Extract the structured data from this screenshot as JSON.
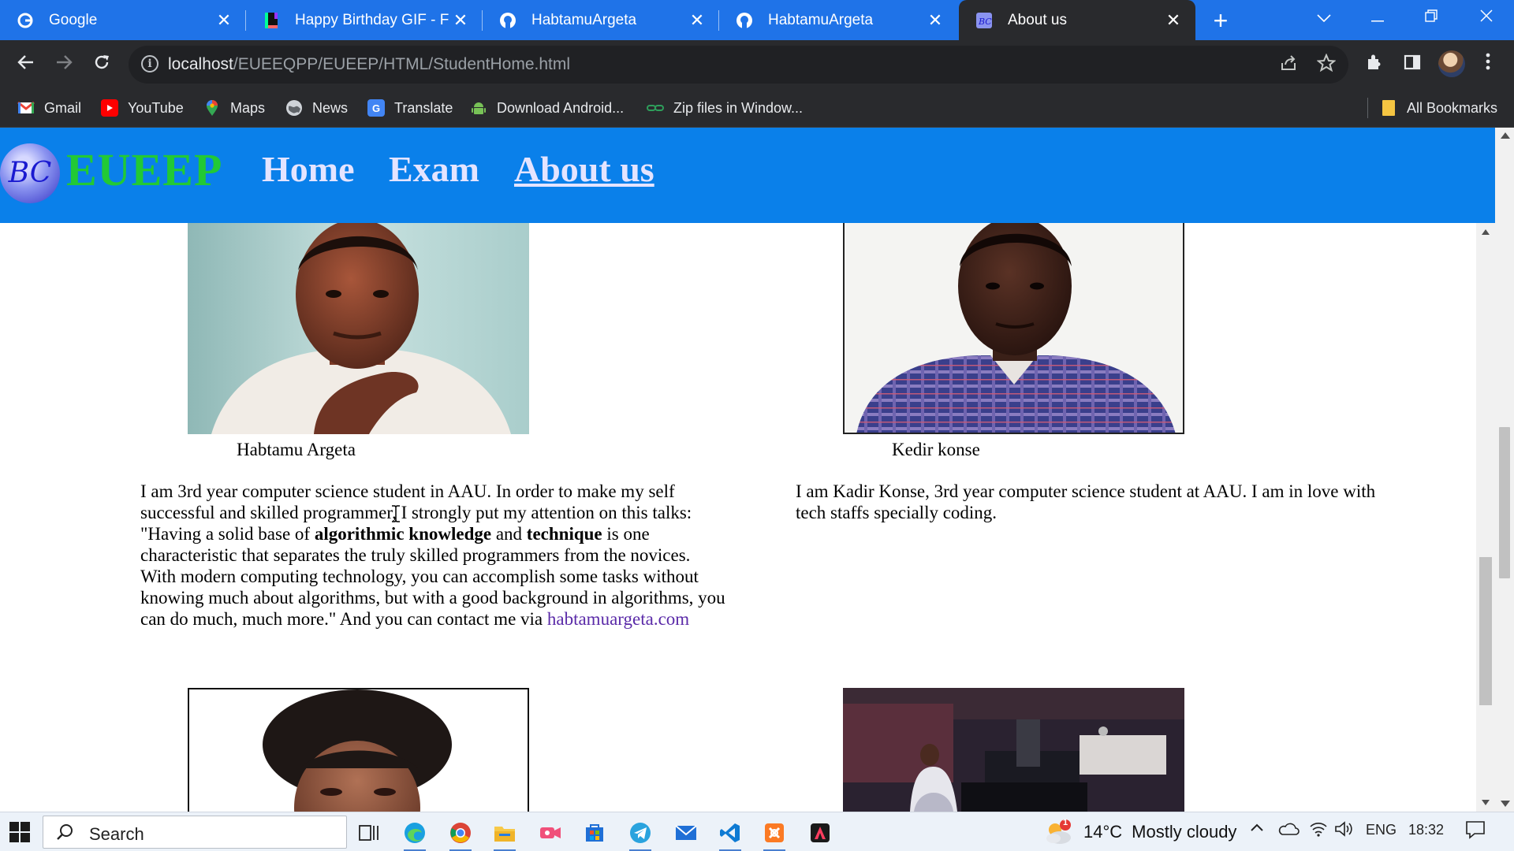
{
  "browser": {
    "tabs": [
      {
        "title": "Google",
        "icon": "google-icon"
      },
      {
        "title": "Happy Birthday GIF - Find",
        "icon": "giphy-icon"
      },
      {
        "title": "HabtamuArgeta",
        "icon": "github-icon"
      },
      {
        "title": "HabtamuArgeta",
        "icon": "github-icon"
      },
      {
        "title": "About us",
        "icon": "bc-logo-icon",
        "active": true
      }
    ],
    "close_glyph": "✕",
    "new_tab_glyph": "+",
    "url_host": "localhost",
    "url_path": "/EUEEQPP/EUEEP/HTML/StudentHome.html",
    "bookmarks": [
      {
        "label": "Gmail",
        "icon": "gmail-icon"
      },
      {
        "label": "YouTube",
        "icon": "youtube-icon"
      },
      {
        "label": "Maps",
        "icon": "maps-icon"
      },
      {
        "label": "News",
        "icon": "news-icon"
      },
      {
        "label": "Translate",
        "icon": "translate-icon"
      },
      {
        "label": "Download Android...",
        "icon": "android-icon"
      },
      {
        "label": "Zip files in Window...",
        "icon": "link-icon"
      }
    ],
    "all_bookmarks": "All Bookmarks"
  },
  "site": {
    "logo_text": "BC",
    "brand": "EUEEP",
    "nav": [
      "Home",
      "Exam",
      "About us"
    ],
    "current_nav": "About us"
  },
  "members": [
    {
      "name": "Habtamu Argeta",
      "bio_parts": [
        {
          "t": "I am 3rd year computer science student in AAU. In order to make my self successful and skilled programmer, I strongly put my attention on this talks: \"Having a solid base of ",
          "b": false
        },
        {
          "t": "algorithmic knowledge",
          "b": true
        },
        {
          "t": " and ",
          "b": false
        },
        {
          "t": "technique",
          "b": true
        },
        {
          "t": " is one characteristic that separates the truly skilled programmers from the novices. With modern computing technology, you can accomplish some tasks without knowing much about algorithms, but with a good background in algorithms, you can do much, much more.\" And you can contact me via ",
          "b": false
        }
      ],
      "link": "habtamuargeta.com"
    },
    {
      "name": "Kedir konse",
      "bio": "I am Kadir Konse, 3rd year computer science student at AAU. I am in love with tech staffs specially coding."
    }
  ],
  "taskbar": {
    "search_placeholder": "Search",
    "weather_temp": "14°C",
    "weather_desc": "Mostly cloudy",
    "weather_badge": "1",
    "language": "ENG",
    "time": "18:32"
  },
  "colors": {
    "site_header": "#0a80ea",
    "brand_green": "#22c935",
    "nav_text": "#e4e4ff",
    "chrome_tabbar": "#1f73e8",
    "chrome_dark": "#292a2d"
  }
}
